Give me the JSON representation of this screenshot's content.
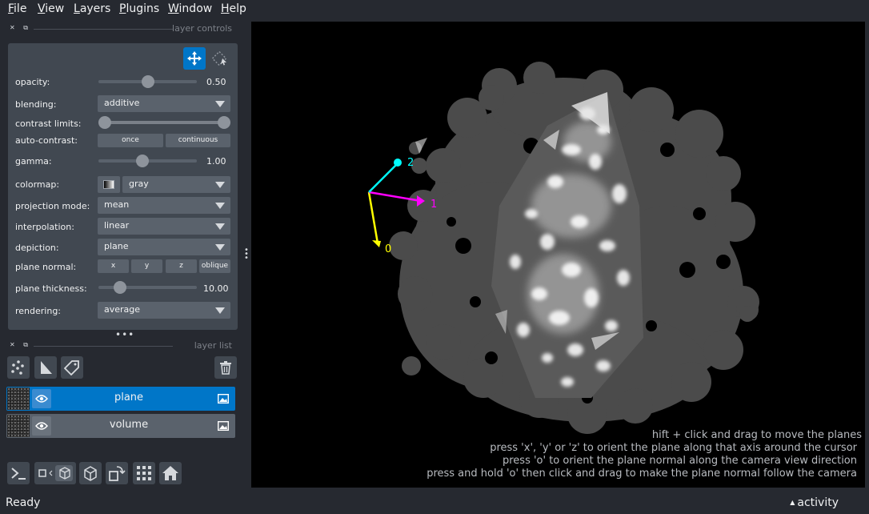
{
  "menu": {
    "items": [
      {
        "accel": "F",
        "rest": "ile"
      },
      {
        "accel": "V",
        "rest": "iew"
      },
      {
        "accel": "L",
        "rest": "ayers"
      },
      {
        "accel": "P",
        "rest": "lugins"
      },
      {
        "accel": "W",
        "rest": "indow"
      },
      {
        "accel": "H",
        "rest": "elp"
      }
    ]
  },
  "layer_controls": {
    "title": "layer controls",
    "opacity": {
      "label": "opacity:",
      "value": "0.50",
      "fraction": 0.5
    },
    "blending": {
      "label": "blending:",
      "value": "additive"
    },
    "contrast_limits": {
      "label": "contrast limits:",
      "low": 0.0,
      "high": 1.0
    },
    "auto_contrast": {
      "label": "auto-contrast:",
      "once": "once",
      "continuous": "continuous"
    },
    "gamma": {
      "label": "gamma:",
      "value": "1.00",
      "fraction": 0.45
    },
    "colormap": {
      "label": "colormap:",
      "value": "gray"
    },
    "projection_mode": {
      "label": "projection mode:",
      "value": "mean"
    },
    "interpolation": {
      "label": "interpolation:",
      "value": "linear"
    },
    "depiction": {
      "label": "depiction:",
      "value": "plane"
    },
    "plane_normal": {
      "label": "plane normal:",
      "x": "x",
      "y": "y",
      "z": "z",
      "oblique": "oblique"
    },
    "plane_thickness": {
      "label": "plane thickness:",
      "value": "10.00",
      "fraction": 0.22
    },
    "rendering": {
      "label": "rendering:",
      "value": "average"
    }
  },
  "layer_list": {
    "title": "layer list",
    "layers": [
      {
        "name": "plane",
        "selected": true
      },
      {
        "name": "volume",
        "selected": false
      }
    ]
  },
  "canvas": {
    "axes": {
      "axis0": "0",
      "axis1": "1",
      "axis2": "2"
    },
    "axis_colors": {
      "axis0": "#ffff00",
      "axis1": "#ff00ff",
      "axis2": "#00ffff"
    },
    "hints": [
      "hift + click and drag to move the planes",
      "press 'x', 'y' or 'z' to orient the plane along that axis around the cursor",
      "press 'o' to orient the plane normal along the camera view direction",
      "press and hold 'o' then click and drag to make the plane normal follow the camera"
    ]
  },
  "status": {
    "text": "Ready",
    "activity": "activity"
  },
  "colors": {
    "background": "#262930",
    "panel": "#414851",
    "accent": "#0076c8",
    "canvas": "#000000"
  }
}
